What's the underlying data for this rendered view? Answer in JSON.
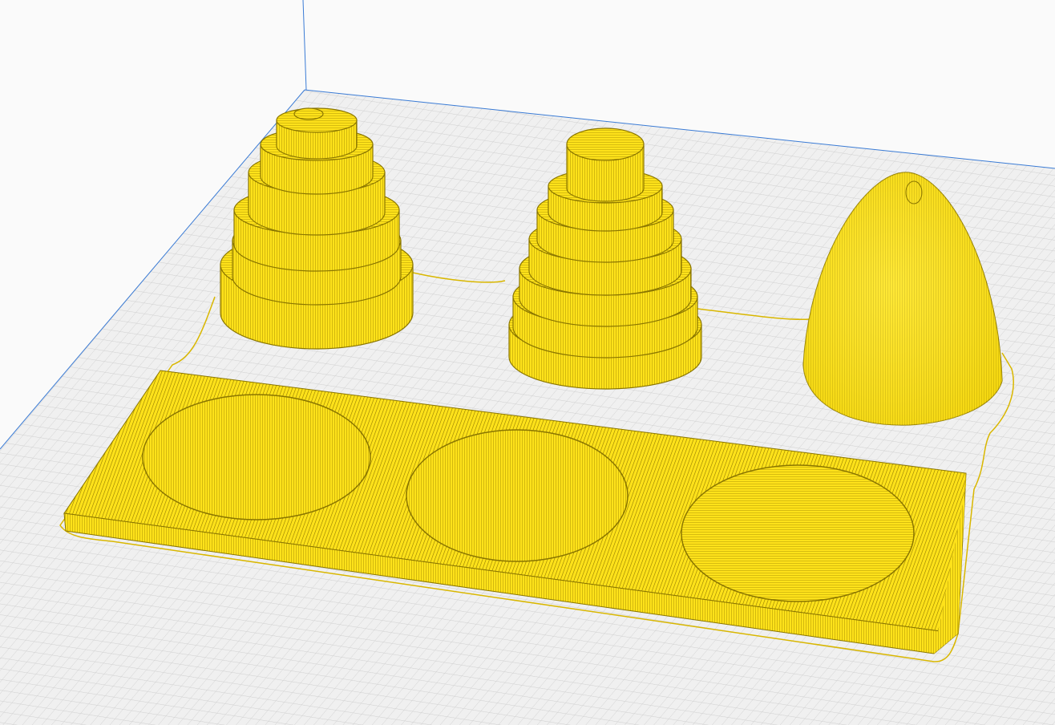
{
  "app": {
    "view": "preview",
    "layer_view": "slice preview"
  },
  "colors": {
    "background": "#fafafa",
    "plate": "#f2f2f2",
    "grid_line": "#c7c7c7",
    "axis_blue": "#3a7bd5",
    "model_yellow": "#ffe21a",
    "model_shadow": "#8a7600",
    "skirt_line": "#d9b700"
  },
  "objects": [
    {
      "name": "stepped-cone-left",
      "type": "stepped-tower",
      "tiers": 7
    },
    {
      "name": "stepped-cone-middle",
      "type": "stepped-tower",
      "tiers": 8
    },
    {
      "name": "paraboloid-nose-cone",
      "type": "paraboloid"
    },
    {
      "name": "base-plate-with-three-recesses",
      "type": "plate",
      "recesses": 3
    }
  ]
}
